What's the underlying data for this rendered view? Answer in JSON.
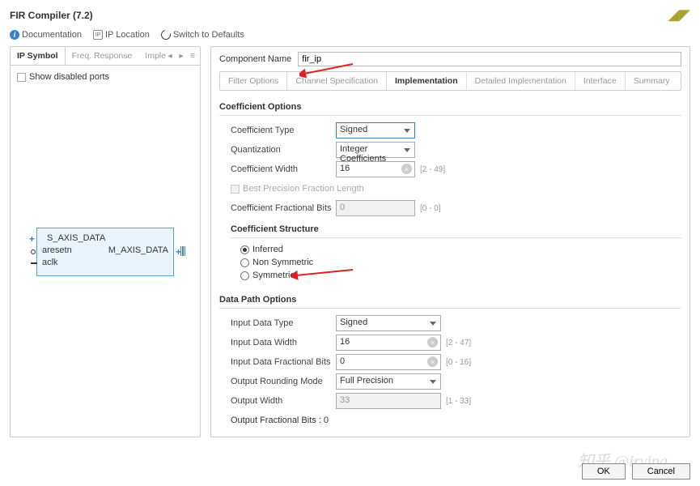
{
  "title": "FIR Compiler (7.2)",
  "toolbar": {
    "doc": "Documentation",
    "loc": "IP Location",
    "reset": "Switch to Defaults"
  },
  "left": {
    "tabs": [
      "IP Symbol",
      "Freq. Response",
      "Implementation Detail"
    ],
    "show_disabled": "Show disabled ports",
    "diagram": {
      "s_axis": "S_AXIS_DATA",
      "aresetn": "aresetn",
      "m_axis": "M_AXIS_DATA",
      "aclk": "aclk"
    }
  },
  "component": {
    "label": "Component Name",
    "value": "fir_ip"
  },
  "tabs": [
    "Filter Options",
    "Channel Specification",
    "Implementation",
    "Detailed Implementation",
    "Interface",
    "Summary"
  ],
  "coef": {
    "section": "Coefficient Options",
    "type_label": "Coefficient Type",
    "type_value": "Signed",
    "quant_label": "Quantization",
    "quant_value": "Integer Coefficients",
    "width_label": "Coefficient Width",
    "width_value": "16",
    "width_range": "[2 - 49]",
    "bp_label": "Best Precision Fraction Length",
    "frac_label": "Coefficient Fractional Bits",
    "frac_value": "0",
    "frac_range": "[0 - 0]",
    "struct_label": "Coefficient Structure",
    "struct_opts": [
      "Inferred",
      "Non Symmetric",
      "Symmetric"
    ]
  },
  "dp": {
    "section": "Data Path Options",
    "itype_label": "Input Data Type",
    "itype_value": "Signed",
    "iwidth_label": "Input Data Width",
    "iwidth_value": "16",
    "iwidth_range": "[2 - 47]",
    "ifrac_label": "Input Data Fractional Bits",
    "ifrac_value": "0",
    "ifrac_range": "[0 - 16]",
    "round_label": "Output Rounding Mode",
    "round_value": "Full Precision",
    "owidth_label": "Output Width",
    "owidth_value": "33",
    "owidth_range": "[1 - 33]",
    "ofrac_label": "Output Fractional Bits : 0"
  },
  "buttons": {
    "ok": "OK",
    "cancel": "Cancel"
  },
  "watermark": "知乎 @irving"
}
